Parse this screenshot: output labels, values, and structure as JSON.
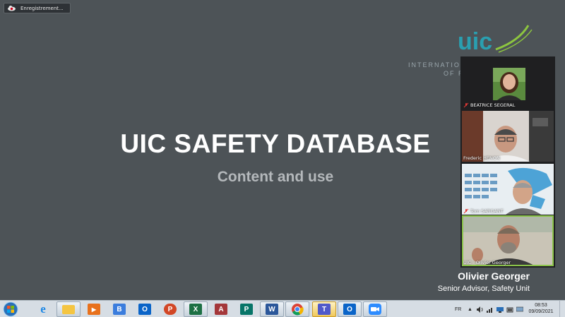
{
  "recording": {
    "label": "Enregistrement..."
  },
  "slide": {
    "title": "UIC SAFETY DATABASE",
    "subtitle": "Content and use",
    "logo_text": "uic",
    "org_line1": "INTERNATIONA",
    "org_line2": "OF R",
    "speaker_name": "Olivier Georger",
    "speaker_role": "Senior Advisor, Safety Unit"
  },
  "participants": [
    {
      "name": "BEATRICE SEGERAL",
      "muted": true
    },
    {
      "name": "Frederic HENON",
      "muted": false
    },
    {
      "name": "Tom SARGANT",
      "muted": true
    },
    {
      "name": "UIC - Olivier Georger",
      "muted": false,
      "active": true
    }
  ],
  "taskbar": {
    "apps": [
      {
        "name": "internet-explorer",
        "glyph": "e",
        "color": "#1e88e5"
      },
      {
        "name": "file-explorer",
        "glyph": "",
        "color": "#f4c542"
      },
      {
        "name": "media-player",
        "glyph": "▶",
        "color": "#e8711c"
      },
      {
        "name": "bluejeans",
        "glyph": "B",
        "color": "#3b7ddd"
      },
      {
        "name": "outlook",
        "glyph": "O",
        "color": "#0a64c8"
      },
      {
        "name": "powerpoint",
        "glyph": "P",
        "color": "#d24726"
      },
      {
        "name": "excel",
        "glyph": "X",
        "color": "#1d7044"
      },
      {
        "name": "access",
        "glyph": "A",
        "color": "#a4373a"
      },
      {
        "name": "publisher",
        "glyph": "P",
        "color": "#077568"
      },
      {
        "name": "word",
        "glyph": "W",
        "color": "#2b579a"
      },
      {
        "name": "chrome",
        "glyph": "",
        "color": "#db4437"
      },
      {
        "name": "teams",
        "glyph": "T",
        "color": "#5059c9"
      },
      {
        "name": "outlook-2",
        "glyph": "O",
        "color": "#0a64c8"
      },
      {
        "name": "zoom",
        "glyph": "",
        "color": "#2d8cff"
      }
    ],
    "language": "FR",
    "time": "08:53",
    "date": "09/09/2021"
  },
  "colors": {
    "background": "#4d5357",
    "logo_teal": "#2a9fb0",
    "logo_green": "#8dc63f",
    "active_border": "#8bc34a"
  }
}
